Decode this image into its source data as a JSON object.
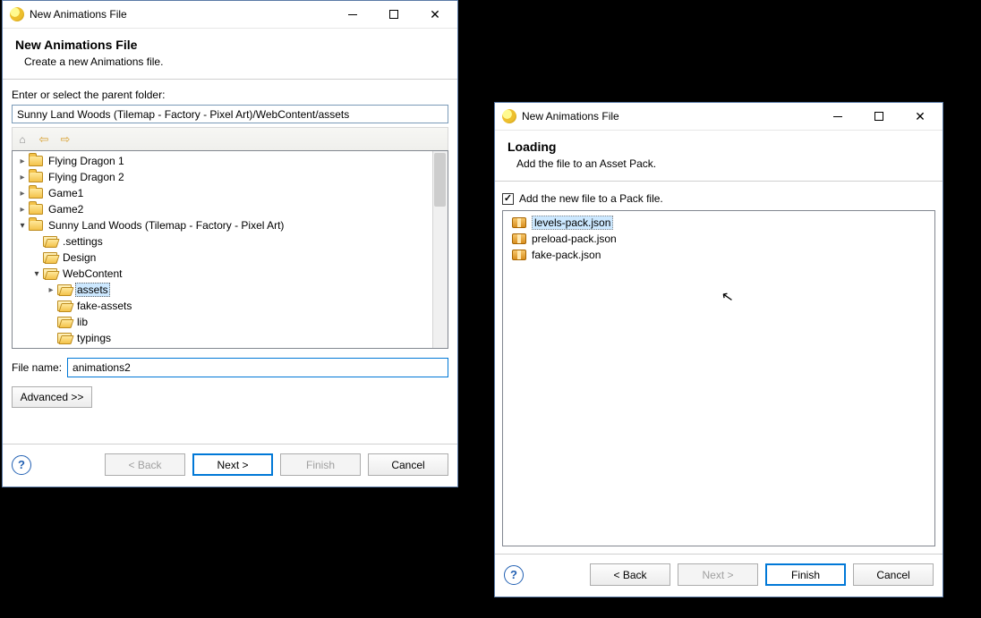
{
  "dialog1": {
    "title": "New Animations File",
    "wizardTitle": "New Animations File",
    "wizardSubtitle": "Create a new Animations file.",
    "parentFolderLabel": "Enter or select the parent folder:",
    "parentFolderValue": "Sunny Land Woods (Tilemap - Factory - Pixel Art)/WebContent/assets",
    "fileNameLabel": "File name:",
    "fileNameValue": "animations2",
    "advancedLabel": "Advanced >>",
    "buttons": {
      "back": "< Back",
      "next": "Next >",
      "finish": "Finish",
      "cancel": "Cancel"
    },
    "tree": [
      {
        "label": "Flying Dragon 1",
        "icon": "project",
        "arrow": "closed",
        "indent": 0
      },
      {
        "label": "Flying Dragon 2",
        "icon": "project",
        "arrow": "closed",
        "indent": 0
      },
      {
        "label": "Game1",
        "icon": "project",
        "arrow": "closed",
        "indent": 0
      },
      {
        "label": "Game2",
        "icon": "project",
        "arrow": "closed",
        "indent": 0
      },
      {
        "label": "Sunny Land Woods (Tilemap - Factory - Pixel Art)",
        "icon": "project",
        "arrow": "open",
        "indent": 0
      },
      {
        "label": ".settings",
        "icon": "folder",
        "arrow": "none",
        "indent": 1
      },
      {
        "label": "Design",
        "icon": "folder",
        "arrow": "none",
        "indent": 1
      },
      {
        "label": "WebContent",
        "icon": "folder",
        "arrow": "open",
        "indent": 1
      },
      {
        "label": "assets",
        "icon": "folder",
        "arrow": "closed",
        "indent": 2,
        "selected": true
      },
      {
        "label": "fake-assets",
        "icon": "folder",
        "arrow": "none",
        "indent": 2
      },
      {
        "label": "lib",
        "icon": "folder",
        "arrow": "none",
        "indent": 2
      },
      {
        "label": "typings",
        "icon": "folder",
        "arrow": "none",
        "indent": 2
      }
    ]
  },
  "dialog2": {
    "title": "New Animations File",
    "wizardTitle": "Loading",
    "wizardSubtitle": "Add the file to an Asset Pack.",
    "checkboxLabel": "Add the new file to a Pack file.",
    "checkboxChecked": true,
    "packs": [
      {
        "label": "levels-pack.json",
        "selected": true
      },
      {
        "label": "preload-pack.json",
        "selected": false
      },
      {
        "label": "fake-pack.json",
        "selected": false
      }
    ],
    "buttons": {
      "back": "< Back",
      "next": "Next >",
      "finish": "Finish",
      "cancel": "Cancel"
    }
  }
}
